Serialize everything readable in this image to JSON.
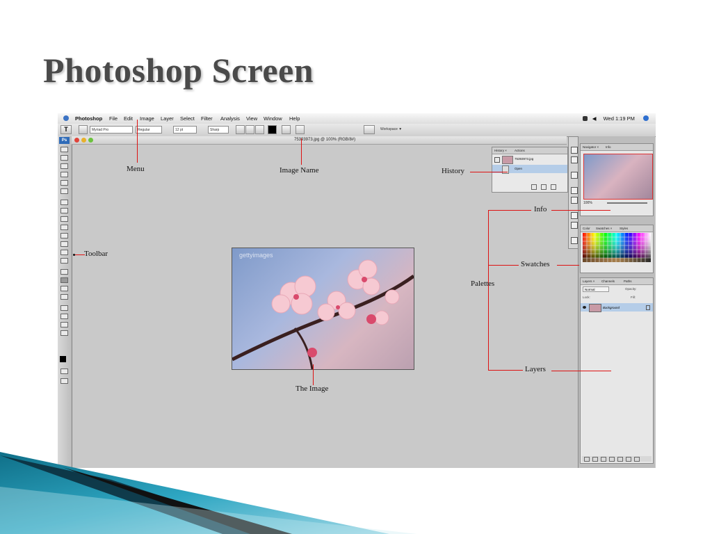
{
  "slide": {
    "title": "Photoshop Screen"
  },
  "menubar": {
    "items": [
      "Photoshop",
      "File",
      "Edit",
      "Image",
      "Layer",
      "Select",
      "Filter",
      "Analysis",
      "View",
      "Window",
      "Help"
    ],
    "clock": "Wed 1:19 PM"
  },
  "options_bar": {
    "tool_letter": "T",
    "font_family": "Myriad Pro",
    "font_style": "Regular",
    "font_size": "12 pt",
    "antialias": "Sharp",
    "workspace": "Workspace ▼"
  },
  "toolbox": {
    "logo": "Ps"
  },
  "document": {
    "title": "75393973.jpg @ 100% (RGB/8#)",
    "watermark": "gettyimages"
  },
  "history_panel": {
    "tabs": [
      "History ×",
      "Actions"
    ],
    "snapshot": "75393973.jpg",
    "state": "Open"
  },
  "navigator_panel": {
    "tabs": [
      "Navigator ×",
      "Info"
    ],
    "zoom": "100%"
  },
  "swatches_panel": {
    "tabs": [
      "Color",
      "Swatches ×",
      "Styles"
    ]
  },
  "layers_panel": {
    "tabs": [
      "Layers ×",
      "Channels",
      "Paths"
    ],
    "blend_mode": "Normal",
    "opacity_label": "Opacity:",
    "lock_label": "Lock:",
    "fill_label": "Fill:",
    "layer_name": "Background"
  },
  "annotations": {
    "menu": "Menu",
    "image_name": "Image Name",
    "history": "History",
    "info": "Info",
    "toolbar": "Toolbar",
    "swatches": "Swatches",
    "palettes": "Palettes",
    "layers": "Layers",
    "the_image": "The Image"
  },
  "colors": {
    "annotation_line": "#d11111",
    "title": "#4a4a4a",
    "deco_teal": "#1a8fa8",
    "deco_black": "#111111"
  }
}
